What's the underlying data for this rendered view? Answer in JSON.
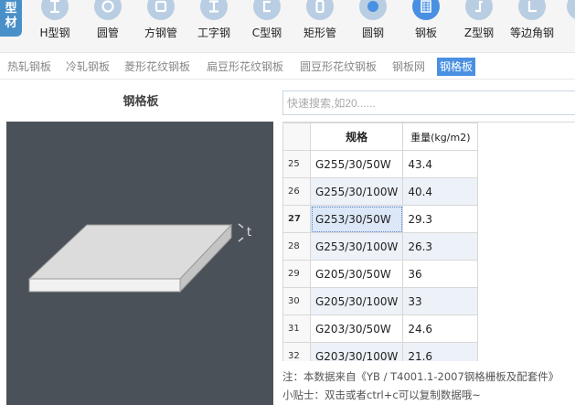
{
  "brand": {
    "line1": "型",
    "line2": "材"
  },
  "categories": [
    {
      "label": "H型钢",
      "icon": "h-beam-icon"
    },
    {
      "label": "圆管",
      "icon": "round-pipe-icon"
    },
    {
      "label": "方钢管",
      "icon": "square-pipe-icon"
    },
    {
      "label": "工字钢",
      "icon": "i-beam-icon"
    },
    {
      "label": "C型钢",
      "icon": "c-channel-icon"
    },
    {
      "label": "矩形管",
      "icon": "rect-pipe-icon"
    },
    {
      "label": "圆钢",
      "icon": "round-bar-icon"
    },
    {
      "label": "钢板",
      "icon": "steel-plate-icon"
    },
    {
      "label": "Z型钢",
      "icon": "z-section-icon"
    },
    {
      "label": "等边角钢",
      "icon": "equal-angle-icon"
    }
  ],
  "active_category": "钢板",
  "subtabs": [
    "热轧钢板",
    "冷轧钢板",
    "菱形花纹钢板",
    "扁豆形花纹钢板",
    "圆豆形花纹钢板",
    "钢板网",
    "钢格板"
  ],
  "active_subtab": "钢格板",
  "preview": {
    "title": "钢格板",
    "dimension_label": "t"
  },
  "search": {
    "placeholder": "快速搜索,如20......",
    "value": ""
  },
  "table": {
    "headers": {
      "spec": "规格",
      "weight": "重量(kg/m2)"
    },
    "rows": [
      {
        "idx": "25",
        "spec": "G255/30/50W",
        "weight": "43.4"
      },
      {
        "idx": "26",
        "spec": "G255/30/100W",
        "weight": "40.4"
      },
      {
        "idx": "27",
        "spec": "G253/30/50W",
        "weight": "29.3"
      },
      {
        "idx": "28",
        "spec": "G253/30/100W",
        "weight": "26.3"
      },
      {
        "idx": "29",
        "spec": "G205/30/50W",
        "weight": "36"
      },
      {
        "idx": "30",
        "spec": "G205/30/100W",
        "weight": "33"
      },
      {
        "idx": "31",
        "spec": "G203/30/50W",
        "weight": "24.6"
      },
      {
        "idx": "32",
        "spec": "G203/30/100W",
        "weight": "21.6"
      }
    ],
    "selected_row": "27"
  },
  "footer": {
    "note": "注：本数据来自《YB / T4001.1-2007钢格栅板及配套件》",
    "tip": "小贴士：双击或者ctrl+c可以复制数据哦~"
  },
  "colors": {
    "accent": "#4a90e2",
    "preview_bg": "#4b5158",
    "selected_cell": "#dce7f7",
    "zebra": "#edf1f8"
  }
}
